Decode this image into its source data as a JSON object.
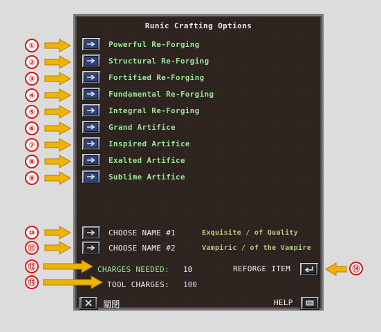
{
  "title": "Runic Crafting Options",
  "colors": {
    "panel_bg": "#2b211d",
    "option_text": "#9ee39a",
    "marker_red": "#d41616",
    "arrow_yellow": "#f0b400"
  },
  "options": [
    {
      "marker": "①",
      "label": "Powerful Re-Forging"
    },
    {
      "marker": "②",
      "label": "Structural Re-Forging"
    },
    {
      "marker": "③",
      "label": "Fortified Re-Forging"
    },
    {
      "marker": "④",
      "label": "Fundamental Re-Forging"
    },
    {
      "marker": "⑤",
      "label": "Integral Re-Forging"
    },
    {
      "marker": "⑥",
      "label": "Grand Artifice"
    },
    {
      "marker": "⑦",
      "label": "Inspired Artifice"
    },
    {
      "marker": "⑧",
      "label": "Exalted Artifice"
    },
    {
      "marker": "⑨",
      "label": "Sublime Artifice"
    }
  ],
  "names": [
    {
      "marker": "⑩",
      "label": "CHOOSE NAME #1",
      "suffix": "Exquisite / of Quality"
    },
    {
      "marker": "⑪",
      "label": "CHOOSE NAME #2",
      "suffix": "Vampiric / of the Vampire"
    }
  ],
  "charges": {
    "marker": "⑫",
    "needed_label": "CHARGES NEEDED:",
    "needed_value": "10"
  },
  "tool": {
    "marker": "⑬",
    "label": "TOOL CHARGES:",
    "value": "100"
  },
  "reforge": {
    "marker": "⑭",
    "label": "REFORGE ITEM"
  },
  "footer": {
    "close_label": "關閉",
    "help_label": "HELP"
  }
}
